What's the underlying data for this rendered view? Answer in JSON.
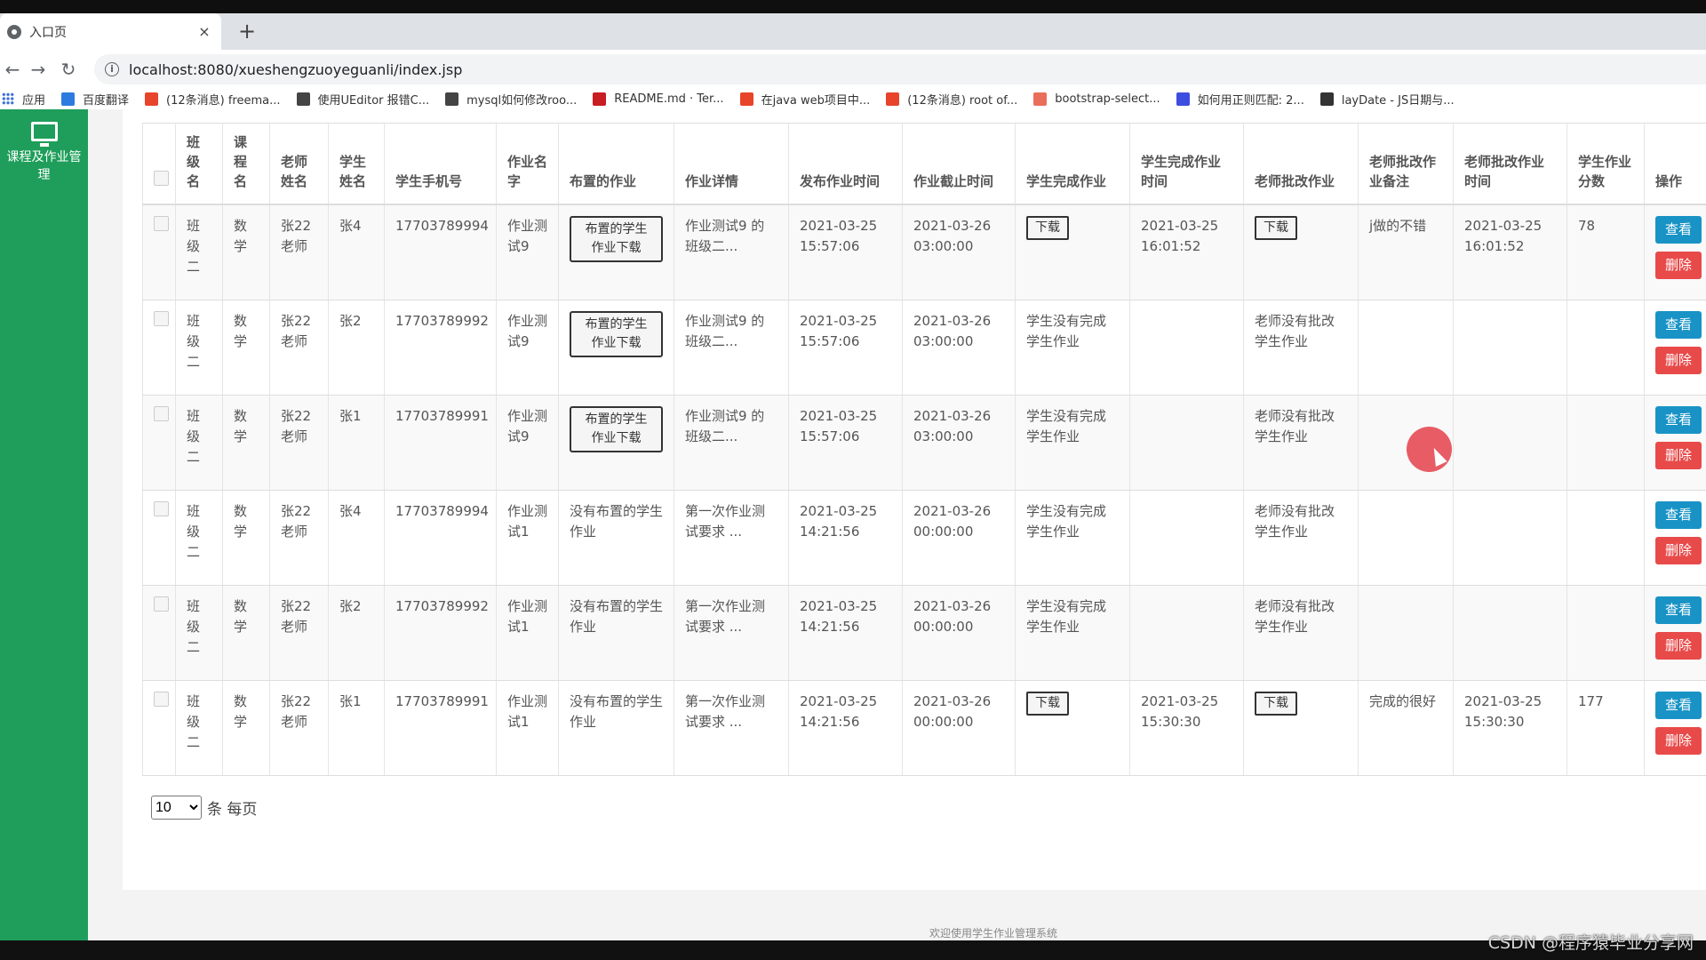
{
  "browser": {
    "tab_title": "入口页",
    "tab_close": "×",
    "new_tab": "+",
    "url": "localhost:8080/xueshengzuoyeguanli/index.jsp",
    "bookmarks": [
      {
        "label": "应用",
        "icon": "apps-grid-icon",
        "color": "#3b6fd8"
      },
      {
        "label": "百度翻译",
        "icon": "baidu-translate-icon",
        "color": "#2d7be0"
      },
      {
        "label": "(12条消息) freema...",
        "icon": "csdn-icon",
        "color": "#e8442c"
      },
      {
        "label": "使用UEditor 报错C...",
        "icon": "gear-logo-icon",
        "color": "#444444"
      },
      {
        "label": "mysql如何修改roo...",
        "icon": "gear-logo-icon",
        "color": "#444444"
      },
      {
        "label": "README.md · Ter...",
        "icon": "gitee-icon",
        "color": "#c71d23"
      },
      {
        "label": "在java web项目中...",
        "icon": "csdn-icon",
        "color": "#e8442c"
      },
      {
        "label": "(12条消息) root of...",
        "icon": "csdn-icon",
        "color": "#e8442c"
      },
      {
        "label": "bootstrap-select...",
        "icon": "jianshu-icon",
        "color": "#ea6f5a"
      },
      {
        "label": "如何用正则匹配: 2...",
        "icon": "baidu-paw-icon",
        "color": "#3d4de0"
      },
      {
        "label": "layDate - JS日期与...",
        "icon": "laydate-icon",
        "color": "#333333"
      }
    ]
  },
  "sidebar": {
    "label_line1": "课程及作业管",
    "label_line2": "理",
    "icon": "monitor-icon"
  },
  "table": {
    "headers": [
      "班级名",
      "课程名",
      "老师姓名",
      "学生姓名",
      "学生手机号",
      "作业名字",
      "布置的作业",
      "作业详情",
      "发布作业时间",
      "作业截止时间",
      "学生完成作业",
      "学生完成作业时间",
      "老师批改作业",
      "老师批改作业备注",
      "老师批改作业时间",
      "学生作业分数",
      "操作"
    ],
    "rows": [
      {
        "class": "班级二",
        "course": "数学",
        "teacher": "张22老师",
        "student": "张4",
        "phone": "17703789994",
        "hw_name": "作业测试9",
        "assigned": "布置的学生作业下载",
        "assigned_is_button": true,
        "detail": "作业测试9 的班级二...",
        "publish": "2021-03-25 15:57:06",
        "deadline": "2021-03-26 03:00:00",
        "student_done": "下载",
        "done_is_button": true,
        "done_time": "2021-03-25 16:01:52",
        "teacher_check": "下载",
        "check_is_button": true,
        "remark": "j做的不错",
        "check_time": "2021-03-25 16:01:52",
        "score": "78"
      },
      {
        "class": "班级二",
        "course": "数学",
        "teacher": "张22老师",
        "student": "张2",
        "phone": "17703789992",
        "hw_name": "作业测试9",
        "assigned": "布置的学生作业下载",
        "assigned_is_button": true,
        "detail": "作业测试9 的班级二...",
        "publish": "2021-03-25 15:57:06",
        "deadline": "2021-03-26 03:00:00",
        "student_done": "学生没有完成学生作业",
        "done_is_button": false,
        "done_time": "",
        "teacher_check": "老师没有批改学生作业",
        "check_is_button": false,
        "remark": "",
        "check_time": "",
        "score": ""
      },
      {
        "class": "班级二",
        "course": "数学",
        "teacher": "张22老师",
        "student": "张1",
        "phone": "17703789991",
        "hw_name": "作业测试9",
        "assigned": "布置的学生作业下载",
        "assigned_is_button": true,
        "detail": "作业测试9 的班级二...",
        "publish": "2021-03-25 15:57:06",
        "deadline": "2021-03-26 03:00:00",
        "student_done": "学生没有完成学生作业",
        "done_is_button": false,
        "done_time": "",
        "teacher_check": "老师没有批改学生作业",
        "check_is_button": false,
        "remark": "",
        "check_time": "",
        "score": ""
      },
      {
        "class": "班级二",
        "course": "数学",
        "teacher": "张22老师",
        "student": "张4",
        "phone": "17703789994",
        "hw_name": "作业测试1",
        "assigned": "没有布置的学生作业",
        "assigned_is_button": false,
        "detail": "第一次作业测试要求 ...",
        "publish": "2021-03-25 14:21:56",
        "deadline": "2021-03-26 00:00:00",
        "student_done": "学生没有完成学生作业",
        "done_is_button": false,
        "done_time": "",
        "teacher_check": "老师没有批改学生作业",
        "check_is_button": false,
        "remark": "",
        "check_time": "",
        "score": ""
      },
      {
        "class": "班级二",
        "course": "数学",
        "teacher": "张22老师",
        "student": "张2",
        "phone": "17703789992",
        "hw_name": "作业测试1",
        "assigned": "没有布置的学生作业",
        "assigned_is_button": false,
        "detail": "第一次作业测试要求 ...",
        "publish": "2021-03-25 14:21:56",
        "deadline": "2021-03-26 00:00:00",
        "student_done": "学生没有完成学生作业",
        "done_is_button": false,
        "done_time": "",
        "teacher_check": "老师没有批改学生作业",
        "check_is_button": false,
        "remark": "",
        "check_time": "",
        "score": ""
      },
      {
        "class": "班级二",
        "course": "数学",
        "teacher": "张22老师",
        "student": "张1",
        "phone": "17703789991",
        "hw_name": "作业测试1",
        "assigned": "没有布置的学生作业",
        "assigned_is_button": false,
        "detail": "第一次作业测试要求 ...",
        "publish": "2021-03-25 14:21:56",
        "deadline": "2021-03-26 00:00:00",
        "student_done": "下载",
        "done_is_button": true,
        "done_time": "2021-03-25 15:30:30",
        "teacher_check": "下载",
        "check_is_button": true,
        "remark": "完成的很好",
        "check_time": "2021-03-25 15:30:30",
        "score": "177"
      }
    ],
    "op_view": "查看",
    "op_delete": "删除"
  },
  "pager": {
    "selected": "10",
    "suffix": "条 每页"
  },
  "footer": {
    "text": "欢迎使用学生作业管理系统"
  },
  "watermark": "CSDN @程序猿毕业分享网",
  "colors": {
    "sidebar": "#1e9e5a",
    "view_button": "#1993c5",
    "delete_button": "#e84a4a"
  }
}
